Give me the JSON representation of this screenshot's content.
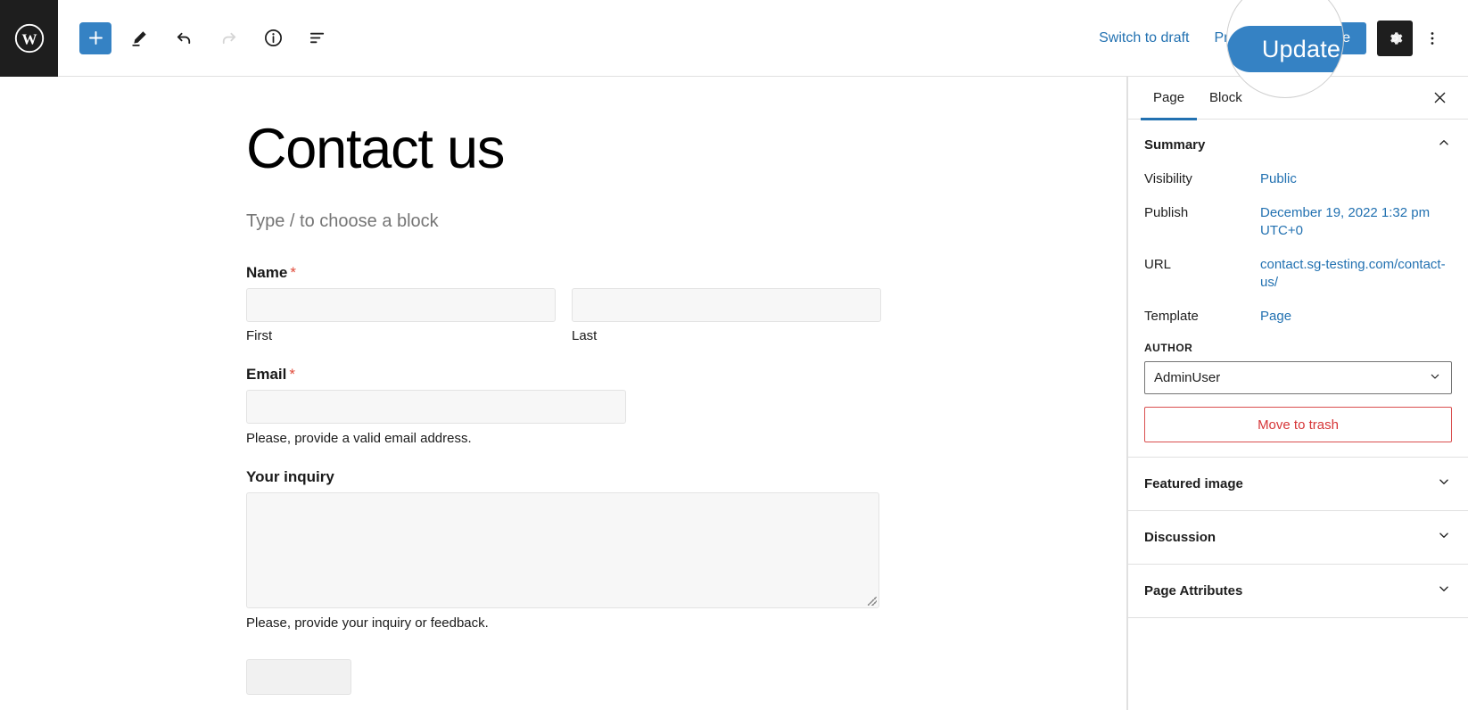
{
  "toolbar": {
    "logo_icon": "wordpress-logo-icon",
    "left_buttons": [
      {
        "name": "add-block-button",
        "icon": "plus-icon",
        "label": "Add block",
        "state": "enabled"
      },
      {
        "name": "tools-button",
        "icon": "pencil-icon",
        "label": "Tools",
        "state": "enabled"
      },
      {
        "name": "undo-button",
        "icon": "undo-arrow-icon",
        "label": "Undo",
        "state": "enabled"
      },
      {
        "name": "redo-button",
        "icon": "redo-arrow-icon",
        "label": "Redo",
        "state": "disabled"
      },
      {
        "name": "details-button",
        "icon": "info-circle-icon",
        "label": "Details",
        "state": "enabled"
      },
      {
        "name": "list-view-button",
        "icon": "list-view-icon",
        "label": "List View",
        "state": "enabled"
      }
    ],
    "switch_to_draft_label": "Switch to draft",
    "preview_label": "Preview",
    "update_label": "Update",
    "settings_icon": "gear-icon",
    "options_icon": "three-dots-vertical-icon",
    "accent_color": "#3582c4",
    "link_color": "#2271b1"
  },
  "magnifier": {
    "target": "update-button",
    "label": "Update"
  },
  "editor": {
    "post_title": "Contact us",
    "block_placeholder": "Type / to choose a block",
    "form": {
      "name_field": {
        "label": "Name",
        "required_marker": "*",
        "first": {
          "sub_label": "First",
          "value": "",
          "placeholder": ""
        },
        "last": {
          "sub_label": "Last",
          "value": "",
          "placeholder": ""
        }
      },
      "email_field": {
        "label": "Email",
        "required_marker": "*",
        "value": "",
        "placeholder": "",
        "help_text": "Please, provide a valid email address."
      },
      "inquiry_field": {
        "label": "Your inquiry",
        "value": "",
        "placeholder": "",
        "help_text": "Please, provide your inquiry or feedback."
      }
    }
  },
  "sidebar": {
    "tabs": [
      {
        "label": "Page",
        "active": true
      },
      {
        "label": "Block",
        "active": false
      }
    ],
    "close_icon": "close-x-icon",
    "summary": {
      "title": "Summary",
      "expanded": true,
      "collapse_icon": "chevron-up-icon",
      "rows": [
        {
          "key": "Visibility",
          "value": "Public"
        },
        {
          "key": "Publish",
          "value": "December 19, 2022 1:32 pm UTC+0"
        },
        {
          "key": "URL",
          "value": "contact.sg-testing.com/contact-us/"
        },
        {
          "key": "Template",
          "value": "Page"
        }
      ],
      "author_label": "AUTHOR",
      "author_value": "AdminUser",
      "author_chevron_icon": "chevron-down-icon",
      "trash_label": "Move to trash",
      "trash_color": "#d63638"
    },
    "collapsed_panels": [
      {
        "label": "Featured image",
        "icon": "chevron-down-icon"
      },
      {
        "label": "Discussion",
        "icon": "chevron-down-icon"
      },
      {
        "label": "Page Attributes",
        "icon": "chevron-down-icon"
      }
    ]
  }
}
